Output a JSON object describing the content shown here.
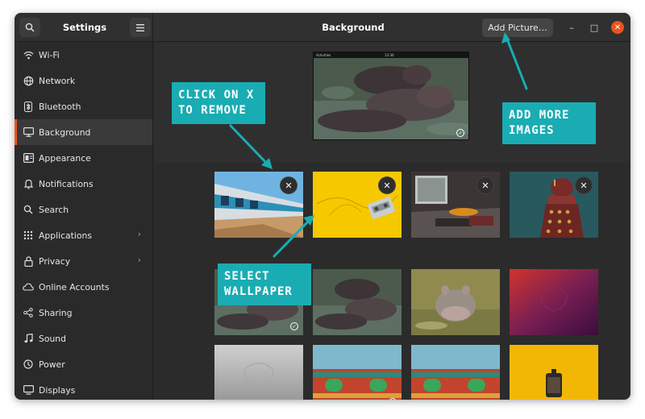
{
  "header": {
    "settings_title": "Settings",
    "window_title": "Background",
    "add_picture_label": "Add Picture…",
    "search_icon": "search-icon",
    "menu_icon": "hamburger-menu-icon",
    "minimize_glyph": "–",
    "maximize_glyph": "□",
    "close_glyph": "✕"
  },
  "sidebar": {
    "items": [
      {
        "label": "Wi-Fi",
        "icon": "wifi-icon"
      },
      {
        "label": "Network",
        "icon": "network-icon"
      },
      {
        "label": "Bluetooth",
        "icon": "bluetooth-icon"
      },
      {
        "label": "Background",
        "icon": "monitor-icon",
        "active": true
      },
      {
        "label": "Appearance",
        "icon": "appearance-icon"
      },
      {
        "label": "Notifications",
        "icon": "bell-icon"
      },
      {
        "label": "Search",
        "icon": "search-icon"
      },
      {
        "label": "Applications",
        "icon": "apps-grid-icon",
        "chevron": true
      },
      {
        "label": "Privacy",
        "icon": "lock-icon",
        "chevron": true
      },
      {
        "label": "Online Accounts",
        "icon": "cloud-icon"
      },
      {
        "label": "Sharing",
        "icon": "share-icon"
      },
      {
        "label": "Sound",
        "icon": "music-note-icon"
      },
      {
        "label": "Power",
        "icon": "power-icon"
      },
      {
        "label": "Displays",
        "icon": "display-icon"
      }
    ],
    "chevron_glyph": "›"
  },
  "preview": {
    "topbar_left": "Activities",
    "topbar_center": "13:30"
  },
  "annotations": {
    "remove": {
      "line1": "CLICK ON X",
      "line2": "TO REMOVE"
    },
    "add_more": {
      "line1": "ADD MORE",
      "line2": "IMAGES"
    },
    "select": {
      "line1": "SELECT",
      "line2": "WALLPAPER"
    }
  },
  "thumbnail": {
    "remove_glyph": "✕",
    "selected_glyph": "✓"
  },
  "colors": {
    "accent_orange": "#e95420",
    "callout_teal": "#1aacb3",
    "window_bg": "#2b2b2b"
  }
}
